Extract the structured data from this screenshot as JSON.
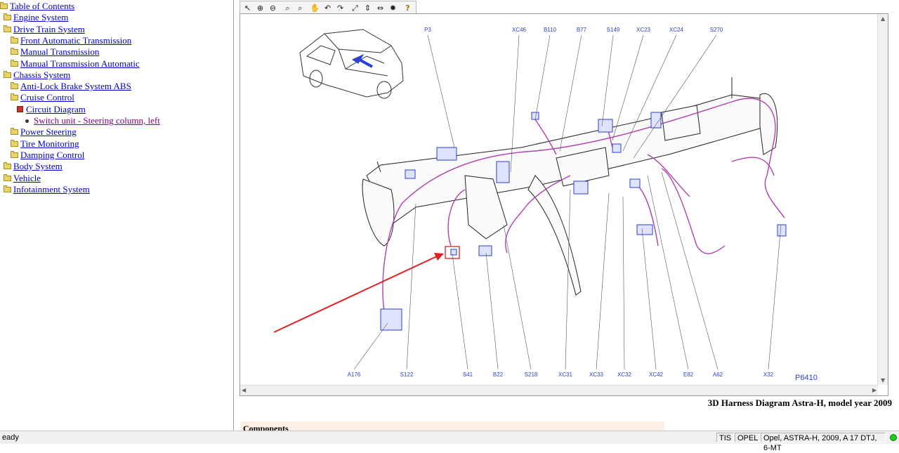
{
  "tree": [
    {
      "label": "Table of Contents",
      "indent": 0,
      "icon": "folder-icon",
      "visited": false
    },
    {
      "label": "Engine System",
      "indent": 1,
      "icon": "folder-icon",
      "visited": false
    },
    {
      "label": "Drive Train System",
      "indent": 1,
      "icon": "folder-icon",
      "visited": false
    },
    {
      "label": "Front Automatic Transmission",
      "indent": 2,
      "icon": "folder-icon",
      "visited": false
    },
    {
      "label": "Manual Transmission",
      "indent": 2,
      "icon": "folder-icon",
      "visited": false
    },
    {
      "label": "Manual Transmission Automatic",
      "indent": 2,
      "icon": "folder-icon",
      "visited": false
    },
    {
      "label": "Chassis System",
      "indent": 1,
      "icon": "folder-icon",
      "visited": false
    },
    {
      "label": "Anti-Lock Brake System ABS",
      "indent": 2,
      "icon": "folder-icon",
      "visited": false
    },
    {
      "label": "Cruise Control",
      "indent": 2,
      "icon": "folder-icon",
      "visited": false
    },
    {
      "label": "Circuit Diagram",
      "indent": 3,
      "icon": "book-icon",
      "visited": false
    },
    {
      "label": "Switch unit - Steering column, left",
      "indent": 4,
      "icon": "bullet-icon",
      "visited": true
    },
    {
      "label": "Power Steering",
      "indent": 2,
      "icon": "folder-icon",
      "visited": false
    },
    {
      "label": "Tire Monitoring",
      "indent": 2,
      "icon": "folder-icon",
      "visited": false
    },
    {
      "label": "Damping Control",
      "indent": 2,
      "icon": "folder-icon",
      "visited": false
    },
    {
      "label": "Body System",
      "indent": 1,
      "icon": "folder-icon",
      "visited": false
    },
    {
      "label": "Vehicle",
      "indent": 1,
      "icon": "folder-icon",
      "visited": false
    },
    {
      "label": "Infotainment System",
      "indent": 1,
      "icon": "folder-icon",
      "visited": false
    }
  ],
  "toolbar": [
    {
      "name": "select-icon",
      "glyph": "↖"
    },
    {
      "name": "zoom-in-icon",
      "glyph": "⊕"
    },
    {
      "name": "zoom-out-icon",
      "glyph": "⊖"
    },
    {
      "name": "zoom-icon",
      "glyph": "⌕"
    },
    {
      "name": "zoom-area-icon",
      "glyph": "⌕"
    },
    {
      "name": "pan-hand-icon",
      "glyph": "✋"
    },
    {
      "name": "rotate-left-icon",
      "glyph": "↶"
    },
    {
      "name": "rotate-right-icon",
      "glyph": "↷"
    },
    {
      "name": "fit-window-icon",
      "glyph": "⤢"
    },
    {
      "name": "fit-height-icon",
      "glyph": "⇕"
    },
    {
      "name": "fit-width-icon",
      "glyph": "⇔"
    },
    {
      "name": "highlight-icon",
      "glyph": "✹"
    },
    {
      "name": "help-icon",
      "glyph": "?"
    }
  ],
  "diagram": {
    "top_labels": [
      "P3",
      "XC46",
      "B110",
      "B77",
      "S149",
      "XC23",
      "XC24",
      "S270"
    ],
    "bottom_labels": [
      "A176",
      "S122",
      "S41",
      "B22",
      "S218",
      "XC31",
      "XC33",
      "XC32",
      "XC42",
      "E82",
      "A62",
      "X32"
    ],
    "figure_id": "P6410",
    "caption": "3D Harness Diagram Astra-H, model year 2009",
    "components_heading": "Components",
    "colors": {
      "harness": "#b040b0",
      "connector": "#2a3fd6",
      "highlight": "#e02020",
      "label": "#2a3fd6"
    }
  },
  "status": {
    "left": "eady",
    "app": "TIS",
    "brand": "OPEL",
    "vehicle": "Opel, ASTRA-H, 2009, A 17 DTJ, 6-MT"
  }
}
